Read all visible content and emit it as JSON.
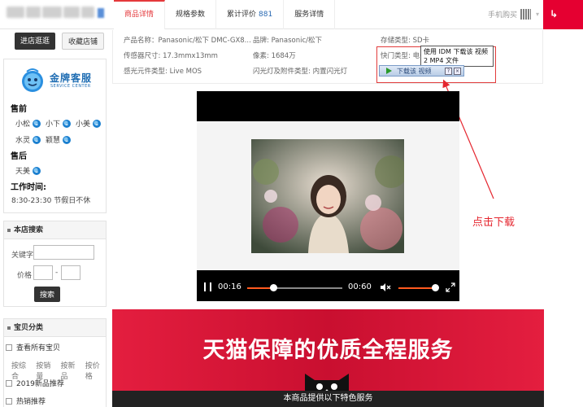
{
  "header": {
    "tabs": [
      {
        "label": "商品详情",
        "active": true
      },
      {
        "label": "规格参数"
      },
      {
        "label": "累计评价",
        "count": "881"
      },
      {
        "label": "服务详情"
      }
    ],
    "mobile_buy": "手机购买"
  },
  "sidebar": {
    "btn_enter_shop": "进店逛逛",
    "btn_favorite": "收藏店铺",
    "service": {
      "logo_title": "金牌客服",
      "logo_sub": "SERVICE CENTER",
      "presale_title": "售前",
      "presale_staff": [
        "小松",
        "小下",
        "小美",
        "水灵",
        "颖慧"
      ],
      "aftersale_title": "售后",
      "aftersale_staff": [
        "天美"
      ],
      "hours_title": "工作时间:",
      "hours": "8:30-23:30 节假日不休"
    },
    "search": {
      "title": "本店搜索",
      "keyword_label": "关键字",
      "price_label": "价格",
      "price_sep": "-",
      "button": "搜索"
    },
    "categories": {
      "title": "宝贝分类",
      "items": [
        "查看所有宝贝",
        "2019新品推荐",
        "热销推荐"
      ],
      "sort_links": [
        "按综合",
        "按销量",
        "按新品",
        "按价格"
      ]
    }
  },
  "attributes": [
    "产品名称：Panasonic/松下 DMC-GX8...",
    "品牌: Panasonic/松下",
    "存储类型: SD卡",
    "传感器尺寸: 17.3mmx13mm",
    "像素: 1684万",
    "快门类型: 电子...",
    "感光元件类型: Live MOS",
    "闪光灯及附件类型: 内置闪光灯"
  ],
  "idm": {
    "tooltip_line1": "使用 IDM 下载该 视频",
    "tooltip_line2": "2 MP4 文件",
    "bar_label": "下载该 视频",
    "help": "?",
    "close": "×"
  },
  "annotation": {
    "click_label": "点击下载",
    "color": "#e5262f"
  },
  "player": {
    "current_time": "00:16",
    "duration": "00:60",
    "progress_fraction": 0.27,
    "accent_color": "#ff5a1f"
  },
  "banner": {
    "title": "天猫保障的优质全程服务",
    "footer": "本商品提供以下特色服务"
  }
}
